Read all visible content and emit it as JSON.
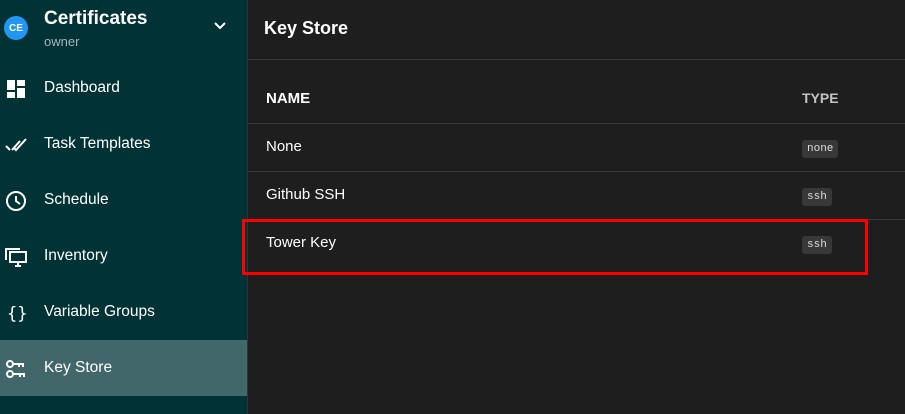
{
  "project": {
    "initials": "CE",
    "name": "Certificates",
    "role": "owner"
  },
  "nav": [
    {
      "label": "Dashboard",
      "icon": "dashboard-icon"
    },
    {
      "label": "Task Templates",
      "icon": "double-check-icon"
    },
    {
      "label": "Schedule",
      "icon": "clock-icon"
    },
    {
      "label": "Inventory",
      "icon": "monitor-icon"
    },
    {
      "label": "Variable Groups",
      "icon": "braces-icon"
    },
    {
      "label": "Key Store",
      "icon": "key-icon",
      "active": true
    }
  ],
  "page": {
    "title": "Key Store"
  },
  "table": {
    "headers": [
      "NAME",
      "TYPE"
    ],
    "rows": [
      {
        "name": "None",
        "type": "none"
      },
      {
        "name": "Github SSH",
        "type": "ssh"
      },
      {
        "name": "Tower Key",
        "type": "ssh"
      }
    ]
  }
}
